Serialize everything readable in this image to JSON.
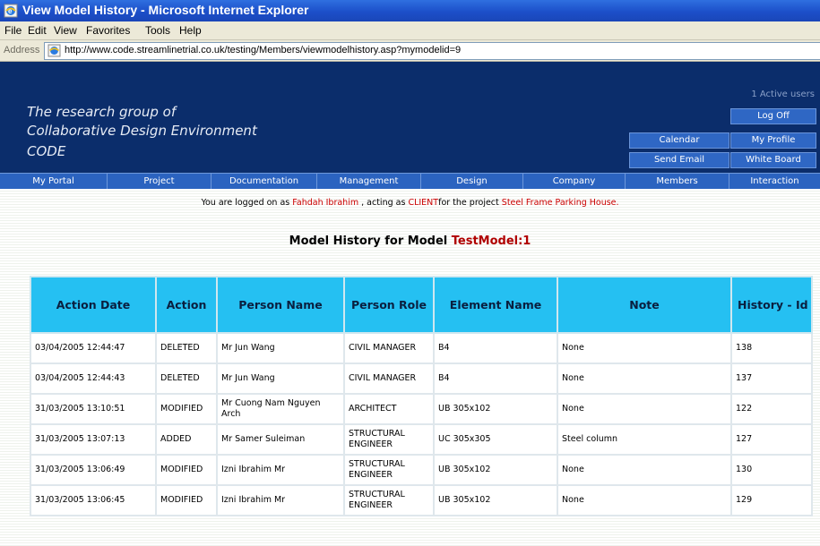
{
  "window": {
    "title": "View Model History - Microsoft Internet Explorer"
  },
  "menu": [
    "File",
    "Edit",
    "View",
    "Favorites",
    "Tools",
    "Help"
  ],
  "address": {
    "label": "Address",
    "url": "http://www.code.streamlinetrial.co.uk/testing/Members/viewmodelhistory.asp?mymodelid=9"
  },
  "header": {
    "group_line1": "The research group of",
    "group_line2": "Collaborative Design Environment",
    "group_line3": "CODE",
    "active_users": "1 Active users",
    "buttons": {
      "log_off": "Log Off",
      "calendar": "Calendar",
      "my_profile": "My Profile",
      "send_email": "Send Email",
      "white_board": "White Board"
    }
  },
  "nav": [
    "My Portal",
    "Project",
    "Documentation",
    "Management",
    "Design",
    "Company",
    "Members",
    "Interaction"
  ],
  "status": {
    "prefix": "You are logged on as",
    "user": "Fahdah  Ibrahim",
    "middle": ", acting as",
    "role": "CLIENT",
    "middle2": "for the project",
    "project": "Steel Frame Parking House."
  },
  "heading": {
    "prefix": "Model History for Model",
    "model": "TestModel:1"
  },
  "table": {
    "columns": [
      "Action Date",
      "Action",
      "Person Name",
      "Person Role",
      "Element Name",
      "Note",
      "History - Id"
    ],
    "rows": [
      [
        "03/04/2005 12:44:47",
        "DELETED",
        "Mr Jun Wang",
        "CIVIL MANAGER",
        "B4",
        "None",
        "138"
      ],
      [
        "03/04/2005 12:44:43",
        "DELETED",
        "Mr Jun Wang",
        "CIVIL MANAGER",
        "B4",
        "None",
        "137"
      ],
      [
        "31/03/2005 13:10:51",
        "MODIFIED",
        "Mr Cuong Nam Nguyen Arch",
        "ARCHITECT",
        "UB 305x102",
        "None",
        "122"
      ],
      [
        "31/03/2005 13:07:13",
        "ADDED",
        "Mr Samer Suleiman",
        "STRUCTURAL ENGINEER",
        "UC 305x305",
        "Steel column",
        "127"
      ],
      [
        "31/03/2005 13:06:49",
        "MODIFIED",
        "Izni Ibrahim Mr",
        "STRUCTURAL ENGINEER",
        "UB 305x102",
        "None",
        "130"
      ],
      [
        "31/03/2005 13:06:45",
        "MODIFIED",
        "Izni Ibrahim Mr",
        "STRUCTURAL ENGINEER",
        "UB 305x102",
        "None",
        "129"
      ]
    ]
  },
  "colors": {
    "header_bg": "#0b2d6b",
    "nav_bg": "#2b63c0",
    "table_header_bg": "#25c0f2",
    "highlight_red": "#cc0000"
  },
  "icons": {
    "title_icon": "ie-page-icon",
    "address_icon": "ie-page-icon"
  }
}
